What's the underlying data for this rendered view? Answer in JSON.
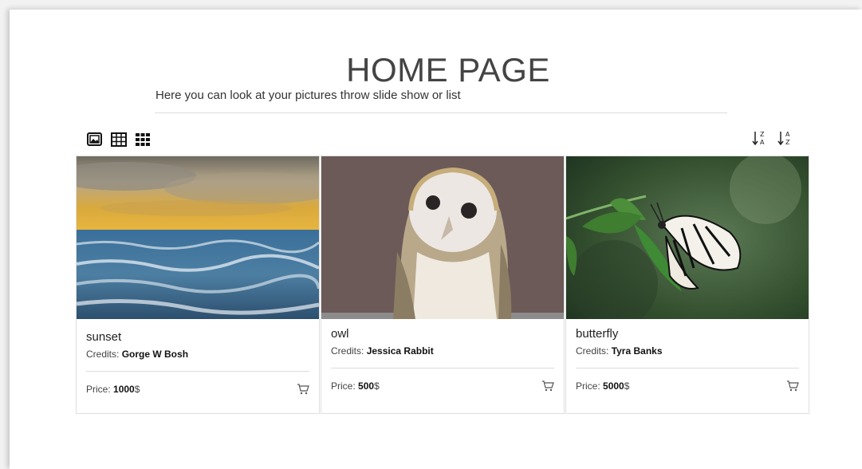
{
  "header": {
    "title": "HOME PAGE",
    "subtitle": "Here you can look at your pictures throw slide show or list"
  },
  "toolbar": {
    "view_icons": [
      "slideshow-icon",
      "table-icon",
      "grid-icon"
    ],
    "sort_icons": [
      "sort-z-a-icon",
      "sort-a-z-icon"
    ]
  },
  "cards": [
    {
      "title": "sunset",
      "credits_label": "Credits:",
      "credits_name": "Gorge W Bosh",
      "price_label": "Price:",
      "price_value": "1000",
      "currency": "$"
    },
    {
      "title": "owl",
      "credits_label": "Credits:",
      "credits_name": "Jessica Rabbit",
      "price_label": "Price:",
      "price_value": "500",
      "currency": "$"
    },
    {
      "title": "butterfly",
      "credits_label": "Credits:",
      "credits_name": "Tyra Banks",
      "price_label": "Price:",
      "price_value": "5000",
      "currency": "$"
    }
  ],
  "colors": {
    "accent_text": "#212529",
    "border": "#dfdfdf"
  }
}
